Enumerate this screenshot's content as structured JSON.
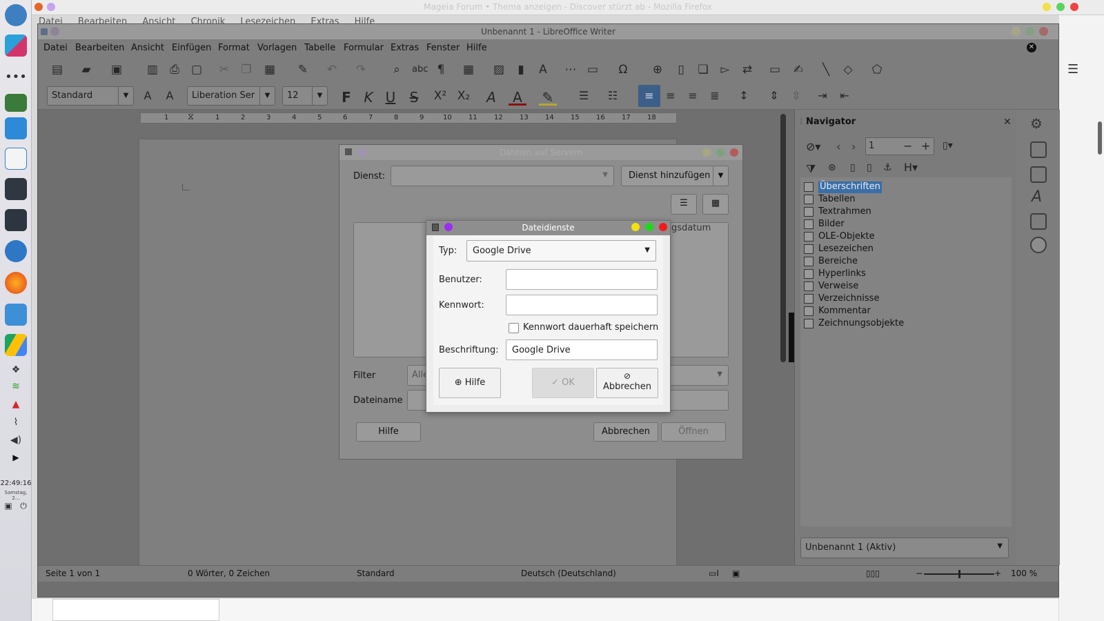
{
  "dock": {
    "clock": "22:49:16",
    "date": "Samstag, 2..."
  },
  "firefox": {
    "title": "Mageia Forum • Thema anzeigen - Discover stürzt ab - Mozilla Firefox",
    "menu": [
      "Datei",
      "Bearbeiten",
      "Ansicht",
      "Chronik",
      "Lesezeichen",
      "Extras",
      "Hilfe"
    ]
  },
  "writer": {
    "title": "Unbenannt 1 - LibreOffice Writer",
    "menu": [
      "Datei",
      "Bearbeiten",
      "Ansicht",
      "Einfügen",
      "Format",
      "Vorlagen",
      "Tabelle",
      "Formular",
      "Extras",
      "Fenster",
      "Hilfe"
    ],
    "para_style": "Standard",
    "font_name": "Liberation Ser",
    "font_size": "12",
    "ruler_numbers": [
      "1",
      "1",
      "2",
      "3",
      "4",
      "5",
      "6",
      "7",
      "8",
      "9",
      "10",
      "11",
      "12",
      "13",
      "14",
      "15",
      "16",
      "17",
      "18"
    ]
  },
  "navigator": {
    "title": "Navigator",
    "page_number": "1",
    "items": [
      "Überschriften",
      "Tabellen",
      "Textrahmen",
      "Bilder",
      "OLE-Objekte",
      "Lesezeichen",
      "Bereiche",
      "Hyperlinks",
      "Verweise",
      "Verzeichnisse",
      "Kommentar",
      "Zeichnungsobjekte"
    ],
    "selected_index": 0,
    "document": "Unbenannt 1 (Aktiv)"
  },
  "statusbar": {
    "page": "Seite 1 von 1",
    "words": "0 Wörter, 0 Zeichen",
    "style": "Standard",
    "language": "Deutsch (Deutschland)",
    "zoom": "100 %"
  },
  "files_dialog": {
    "title": "Dateien auf Servern",
    "service_label": "Dienst:",
    "add_service": "Dienst hinzufügen",
    "column_partial": "gsdatum",
    "filter_label": "Filter",
    "filter_value": "Alle",
    "filename_label": "Dateiname",
    "help": "Hilfe",
    "cancel": "Abbrechen",
    "open": "Öffnen"
  },
  "dialog": {
    "title": "Dateidienste",
    "type_label": "Typ:",
    "type_value": "Google Drive",
    "user_label": "Benutzer:",
    "user_value": "",
    "password_label": "Kennwort:",
    "password_value": "",
    "remember_label": "Kennwort dauerhaft speichern",
    "remember_checked": false,
    "caption_label": "Beschriftung:",
    "caption_value": "Google Drive",
    "help": "Hilfe",
    "ok": "OK",
    "cancel": "Abbrechen"
  }
}
